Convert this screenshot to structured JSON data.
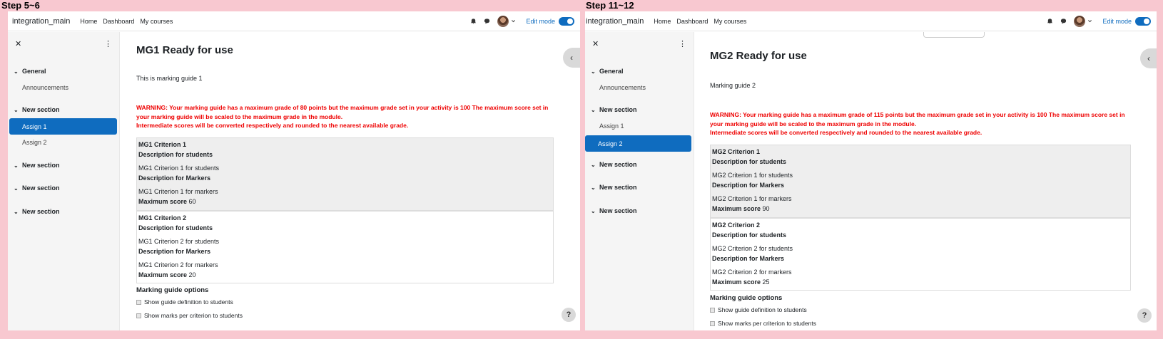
{
  "left": {
    "step_label": "Step 5~6",
    "topnav": {
      "brand": "integration_main",
      "links": [
        "Home",
        "Dashboard",
        "My courses"
      ],
      "edit_mode_label": "Edit mode"
    },
    "drawer": {
      "close_icon": "close-icon",
      "menu_icon": "kebab-icon",
      "sections": [
        {
          "label": "General",
          "items": [
            "Announcements"
          ]
        },
        {
          "label": "New section",
          "items": [
            "Assign 1",
            "Assign 2"
          ]
        },
        {
          "label": "New section",
          "items": []
        },
        {
          "label": "New section",
          "items": []
        },
        {
          "label": "New section",
          "items": []
        }
      ],
      "active_item": "Assign 1"
    },
    "main": {
      "title": "MG1 Ready for use",
      "description": "This is marking guide 1",
      "warning_lines": [
        "WARNING: Your marking guide has a maximum grade of 80 points but the maximum grade set in your activity is 100 The maximum score set in",
        "your marking guide will be scaled to the maximum grade in the module.",
        "Intermediate scores will be converted respectively and rounded to the nearest available grade."
      ],
      "criteria": [
        {
          "name": "MG1 Criterion 1",
          "students_label": "Description for students",
          "students_text": "MG1 Criterion 1 for students",
          "markers_label": "Description for Markers",
          "markers_text": "MG1 Criterion 1 for markers",
          "max_label": "Maximum score",
          "max_value": "60"
        },
        {
          "name": "MG1 Criterion 2",
          "students_label": "Description for students",
          "students_text": "MG1 Criterion 2 for students",
          "markers_label": "Description for Markers",
          "markers_text": "MG1 Criterion 2 for markers",
          "max_label": "Maximum score",
          "max_value": "20"
        }
      ],
      "options_title": "Marking guide options",
      "options": [
        "Show guide definition to students",
        "Show marks per criterion to students"
      ],
      "help": "?"
    }
  },
  "right": {
    "step_label": "Step 11~12",
    "topnav": {
      "brand": "integration_main",
      "links": [
        "Home",
        "Dashboard",
        "My courses"
      ],
      "edit_mode_label": "Edit mode"
    },
    "drawer": {
      "close_icon": "close-icon",
      "menu_icon": "kebab-icon",
      "sections": [
        {
          "label": "General",
          "items": [
            "Announcements"
          ]
        },
        {
          "label": "New section",
          "items": [
            "Assign 1",
            "Assign 2"
          ]
        },
        {
          "label": "New section",
          "items": []
        },
        {
          "label": "New section",
          "items": []
        },
        {
          "label": "New section",
          "items": []
        }
      ],
      "active_item": "Assign 2"
    },
    "main": {
      "title": "MG2 Ready for use",
      "description": "Marking guide 2",
      "warning_lines": [
        "WARNING: Your marking guide has a maximum grade of 115 points but the maximum grade set in your activity is 100 The maximum score set in",
        "your marking guide will be scaled to the maximum grade in the module.",
        "Intermediate scores will be converted respectively and rounded to the nearest available grade."
      ],
      "criteria": [
        {
          "name": "MG2 Criterion 1",
          "students_label": "Description for students",
          "students_text": "MG2 Criterion 1 for students",
          "markers_label": "Description for Markers",
          "markers_text": "MG2 Criterion 1 for markers",
          "max_label": "Maximum score",
          "max_value": "90"
        },
        {
          "name": "MG2 Criterion 2",
          "students_label": "Description for students",
          "students_text": "MG2 Criterion 2 for students",
          "markers_label": "Description for Markers",
          "markers_text": "MG2 Criterion 2 for markers",
          "max_label": "Maximum score",
          "max_value": "25"
        }
      ],
      "options_title": "Marking guide options",
      "options": [
        "Show guide definition to students",
        "Show marks per criterion to students"
      ],
      "help": "?"
    }
  },
  "colors": {
    "accent": "#0f6cbf",
    "warning": "#ee0000",
    "frame": "#f8c8d0"
  }
}
